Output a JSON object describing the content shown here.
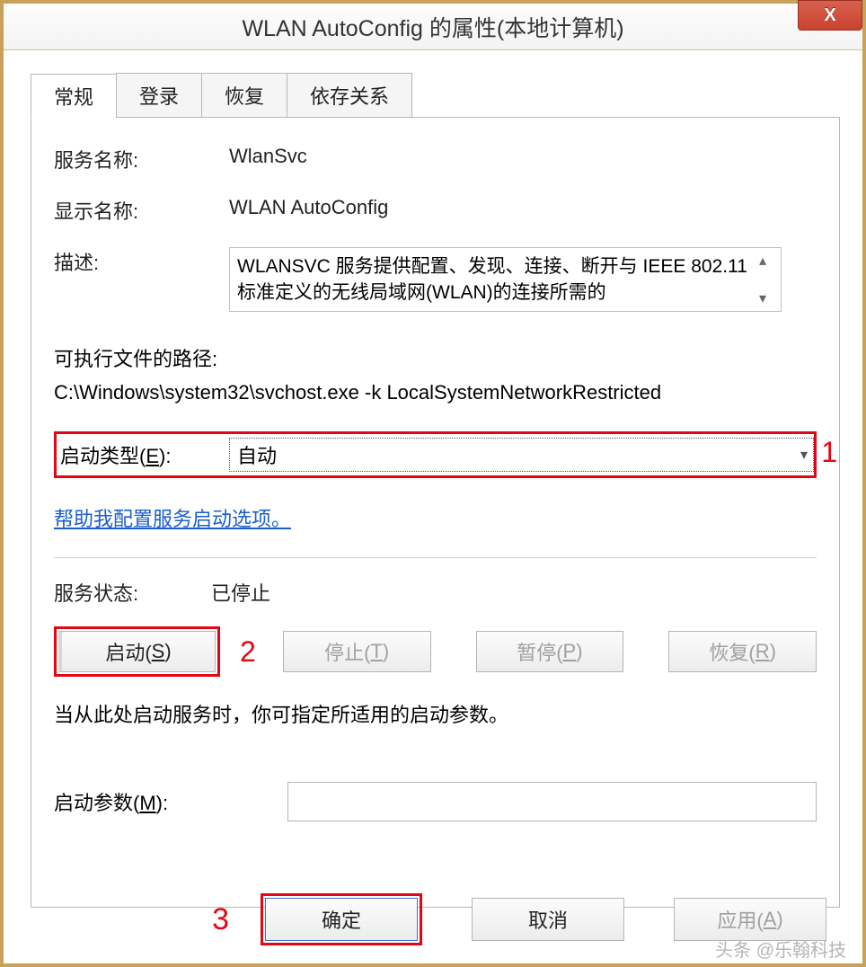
{
  "window": {
    "title": "WLAN AutoConfig 的属性(本地计算机)"
  },
  "tabs": {
    "general": "常规",
    "logon": "登录",
    "recovery": "恢复",
    "deps": "依存关系"
  },
  "fields": {
    "service_name_label": "服务名称:",
    "service_name_value": "WlanSvc",
    "display_name_label": "显示名称:",
    "display_name_value": "WLAN AutoConfig",
    "description_label": "描述:",
    "description_value": "WLANSVC 服务提供配置、发现、连接、断开与 IEEE 802.11 标准定义的无线局域网(WLAN)的连接所需的",
    "exe_path_label": "可执行文件的路径:",
    "exe_path_value": "C:\\Windows\\system32\\svchost.exe -k LocalSystemNetworkRestricted",
    "startup_type_label": "启动类型(E):",
    "startup_type_value": "自动",
    "help_link": "帮助我配置服务启动选项。",
    "service_status_label": "服务状态:",
    "service_status_value": "已停止",
    "note": "当从此处启动服务时，你可指定所适用的启动参数。",
    "start_params_label": "启动参数(M):"
  },
  "buttons": {
    "start": "启动(S)",
    "stop": "停止(T)",
    "pause": "暂停(P)",
    "resume": "恢复(R)",
    "ok": "确定",
    "cancel": "取消",
    "apply": "应用(A)"
  },
  "annotations": {
    "a1": "1",
    "a2": "2",
    "a3": "3"
  },
  "watermark": "头条 @乐翰科技"
}
